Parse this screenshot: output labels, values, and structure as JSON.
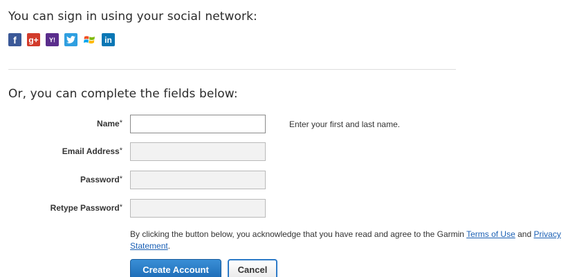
{
  "social": {
    "heading": "You can sign in using your social network:",
    "icons": [
      {
        "name": "facebook-icon",
        "glyph": "f",
        "color": "#3b5998"
      },
      {
        "name": "google-plus-icon",
        "glyph": "g+",
        "color": "#d23b2b"
      },
      {
        "name": "yahoo-icon",
        "glyph": "Y!",
        "color": "#5a2d8c"
      },
      {
        "name": "twitter-icon",
        "glyph": "",
        "color": "#2f9fe0"
      },
      {
        "name": "windows-live-icon",
        "glyph": "",
        "color": "#ffffff"
      },
      {
        "name": "linkedin-icon",
        "glyph": "in",
        "color": "#0a77b5"
      }
    ]
  },
  "form": {
    "heading": "Or, you can complete the fields below:",
    "fields": {
      "name": {
        "label": "Name",
        "required_mark": "*",
        "value": "",
        "placeholder": "",
        "hint": "Enter your first and last name."
      },
      "email": {
        "label": "Email Address",
        "required_mark": "*",
        "value": "",
        "placeholder": ""
      },
      "password": {
        "label": "Password",
        "required_mark": "*",
        "value": "",
        "placeholder": ""
      },
      "retype_password": {
        "label": "Retype Password",
        "required_mark": "*",
        "value": "",
        "placeholder": ""
      }
    },
    "legal": {
      "text_before": "By clicking the button below, you acknowledge that you have read and agree to the Garmin ",
      "terms_link": "Terms of Use",
      "text_between": " and ",
      "privacy_link": "Privacy Statement",
      "text_after": "."
    },
    "buttons": {
      "create_account": "Create Account",
      "cancel": "Cancel"
    }
  },
  "colors": {
    "link": "#1a5fb4",
    "primary_button": "#1c6bb6"
  }
}
